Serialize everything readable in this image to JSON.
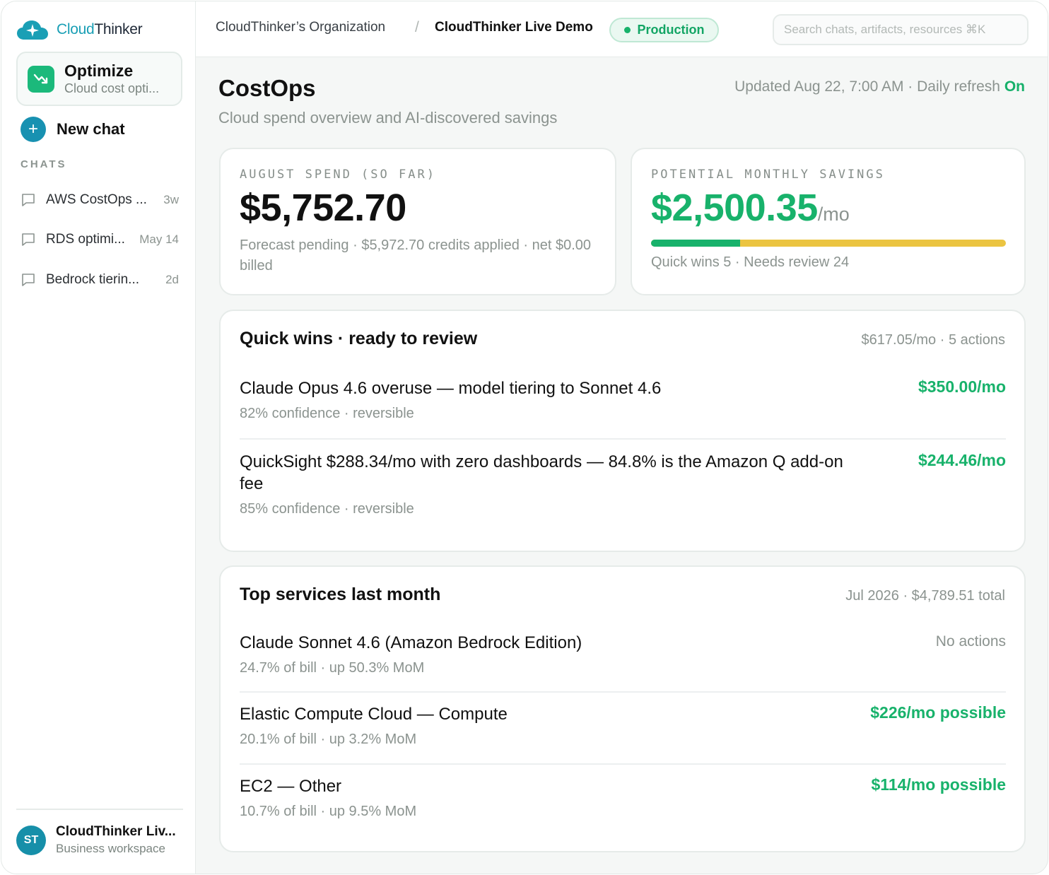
{
  "brand": {
    "part1": "Cloud",
    "part2": "Thinker"
  },
  "agent": {
    "title": "Optimize",
    "subtitle": "Cloud cost opti..."
  },
  "new_chat_label": "New chat",
  "chats_heading": "CHATS",
  "chats": [
    {
      "title": "AWS CostOps ...",
      "time": "3w"
    },
    {
      "title": "RDS optimi...",
      "time": "May 14"
    },
    {
      "title": "Bedrock tierin...",
      "time": "2d"
    }
  ],
  "workspace": {
    "initials": "ST",
    "name": "CloudThinker Liv...",
    "type": "Business workspace"
  },
  "topbar": {
    "org": "CloudThinker’s Organization",
    "separator": "/",
    "project": "CloudThinker Live Demo",
    "environment": "Production",
    "search_placeholder": "Search chats, artifacts, resources ⌘K"
  },
  "page": {
    "title": "CostOps",
    "subtitle": "Cloud spend overview and AI-discovered savings",
    "updated_text": "Updated Aug 22, 7:00 AM · Daily refresh ",
    "refresh_state": "On"
  },
  "spend": {
    "label": "AUGUST SPEND (SO FAR)",
    "value": "$5,752.70",
    "note": "Forecast pending · $5,972.70 credits applied · net $0.00 billed"
  },
  "savings": {
    "label": "POTENTIAL MONTHLY SAVINGS",
    "value": "$2,500.35",
    "unit": "/mo",
    "quick_wins_fraction": 0.25,
    "note": "Quick wins 5 · Needs review 24"
  },
  "quick_wins": {
    "title": "Quick wins · ready to review",
    "meta": "$617.05/mo · 5 actions",
    "items": [
      {
        "title": "Claude Opus 4.6 overuse — model tiering to Sonnet 4.6",
        "sub": "82% confidence · reversible",
        "value": "$350.00/mo"
      },
      {
        "title": "QuickSight $288.34/mo with zero dashboards — 84.8% is the Amazon Q add-on fee",
        "sub": "85% confidence · reversible",
        "value": "$244.46/mo"
      }
    ]
  },
  "top_services": {
    "title": "Top services last month",
    "meta": "Jul 2026 · $4,789.51 total",
    "items": [
      {
        "title": "Claude Sonnet 4.6 (Amazon Bedrock Edition)",
        "sub": "24.7% of bill · up 50.3% MoM",
        "value": "No actions"
      },
      {
        "title": "Elastic Compute Cloud — Compute",
        "sub": "20.1% of bill · up 3.2% MoM",
        "value": "$226/mo possible"
      },
      {
        "title": "EC2 — Other",
        "sub": "10.7% of bill · up 9.5% MoM",
        "value": "$114/mo possible"
      }
    ]
  },
  "colors": {
    "accent_green": "#18b26b",
    "brand_teal": "#1a9fb5",
    "bar_yellow": "#ebc441"
  }
}
